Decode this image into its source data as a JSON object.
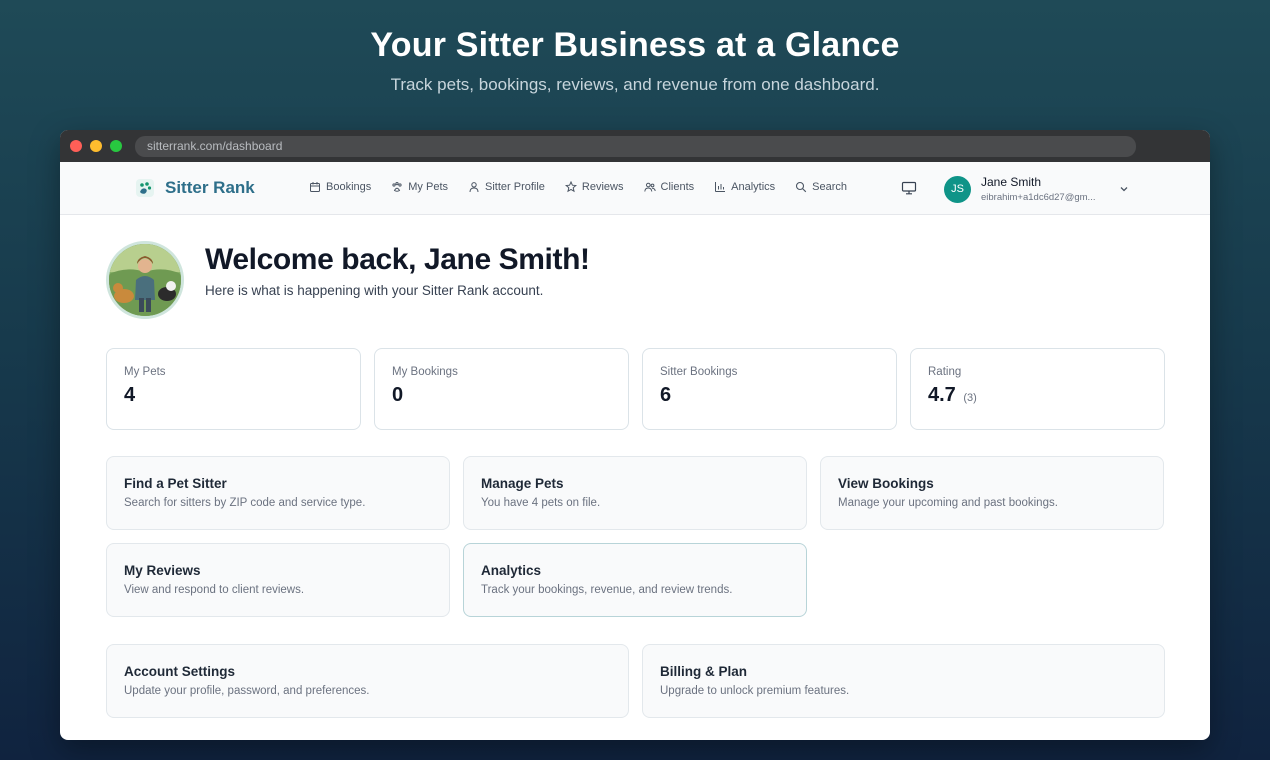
{
  "hero": {
    "title": "Your Sitter Business at a Glance",
    "subtitle": "Track pets, bookings, reviews, and revenue from one dashboard."
  },
  "browser": {
    "url": "sitterrank.com/dashboard"
  },
  "brand": {
    "name": "Sitter Rank",
    "color": "#2e6f8a"
  },
  "nav": {
    "items": [
      {
        "label": "Bookings",
        "icon": "calendar-icon"
      },
      {
        "label": "My Pets",
        "icon": "paw-icon"
      },
      {
        "label": "Sitter Profile",
        "icon": "person-icon"
      },
      {
        "label": "Reviews",
        "icon": "star-icon"
      },
      {
        "label": "Clients",
        "icon": "people-icon"
      },
      {
        "label": "Analytics",
        "icon": "bar-chart-icon"
      },
      {
        "label": "Search",
        "icon": "search-icon"
      }
    ]
  },
  "user": {
    "initials": "JS",
    "name": "Jane Smith",
    "email": "eibrahim+a1dc6d27@gm...",
    "avatar_color": "#0f9488"
  },
  "welcome": {
    "title": "Welcome back, Jane Smith!",
    "subtitle": "Here is what is happening with your Sitter Rank account."
  },
  "stats": [
    {
      "label": "My Pets",
      "value": "4"
    },
    {
      "label": "My Bookings",
      "value": "0"
    },
    {
      "label": "Sitter Bookings",
      "value": "6"
    },
    {
      "label": "Rating",
      "value": "4.7",
      "extra": "(3)"
    }
  ],
  "cards": [
    {
      "title": "Find a Pet Sitter",
      "desc": "Search for sitters by ZIP code and service type."
    },
    {
      "title": "Manage Pets",
      "desc": "You have 4 pets on file."
    },
    {
      "title": "View Bookings",
      "desc": "Manage your upcoming and past bookings."
    },
    {
      "title": "My Reviews",
      "desc": "View and respond to client reviews."
    },
    {
      "title": "Analytics",
      "desc": "Track your bookings, revenue, and review trends."
    },
    {
      "title": "Account Settings",
      "desc": "Update your profile, password, and preferences."
    },
    {
      "title": "Billing & Plan",
      "desc": "Upgrade to unlock premium features."
    }
  ]
}
